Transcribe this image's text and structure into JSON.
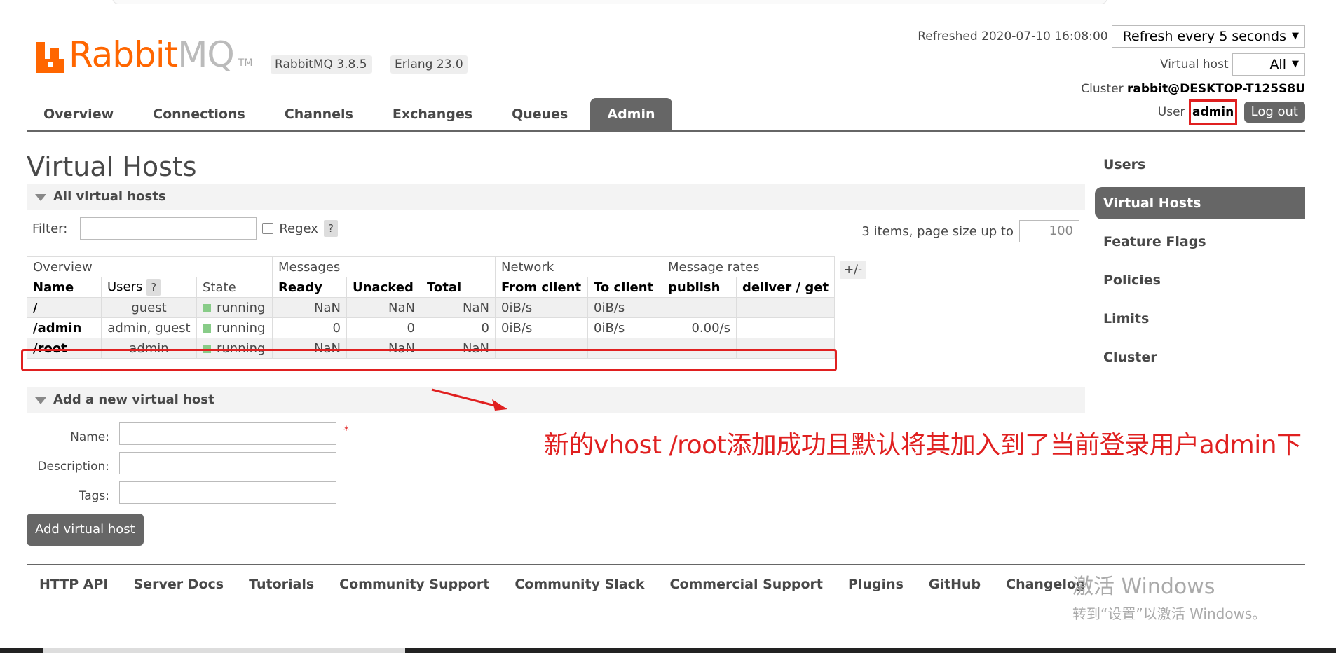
{
  "header": {
    "logo_primary": "Rabbit",
    "logo_secondary": "MQ",
    "logo_tm": "TM",
    "version_badge": "RabbitMQ 3.8.5",
    "erlang_badge": "Erlang 23.0",
    "refreshed_label": "Refreshed 2020-07-10 16:08:00",
    "refresh_select": "Refresh every 5 seconds",
    "vhost_label": "Virtual host",
    "vhost_select": "All",
    "cluster_label": "Cluster",
    "cluster_value": "rabbit@DESKTOP-T125S8U",
    "user_label": "User",
    "user_value": "admin",
    "logout_label": "Log out"
  },
  "tabs": [
    {
      "label": "Overview"
    },
    {
      "label": "Connections"
    },
    {
      "label": "Channels"
    },
    {
      "label": "Exchanges"
    },
    {
      "label": "Queues"
    },
    {
      "label": "Admin",
      "active": true
    }
  ],
  "sidebar": {
    "items": [
      {
        "label": "Users"
      },
      {
        "label": "Virtual Hosts",
        "active": true
      },
      {
        "label": "Feature Flags"
      },
      {
        "label": "Policies"
      },
      {
        "label": "Limits"
      },
      {
        "label": "Cluster"
      }
    ]
  },
  "main": {
    "title": "Virtual Hosts",
    "all_section": "All virtual hosts",
    "filter_label": "Filter:",
    "regex_label": "Regex",
    "help_glyph": "?",
    "pager_text": "3 items, page size up to",
    "page_size": "100",
    "plus_minus": "+/-"
  },
  "table": {
    "groups": [
      "Overview",
      "Messages",
      "Network",
      "Message rates"
    ],
    "columns": [
      "Name",
      "Users",
      "State",
      "Ready",
      "Unacked",
      "Total",
      "From client",
      "To client",
      "publish",
      "deliver / get"
    ],
    "rows": [
      [
        "/",
        "guest",
        "running",
        "NaN",
        "NaN",
        "NaN",
        "0iB/s",
        "0iB/s",
        "",
        ""
      ],
      [
        "/admin",
        "admin, guest",
        "running",
        "0",
        "0",
        "0",
        "0iB/s",
        "0iB/s",
        "0.00/s",
        ""
      ],
      [
        "/root",
        "admin",
        "running",
        "NaN",
        "NaN",
        "NaN",
        "",
        "",
        "",
        ""
      ]
    ]
  },
  "form": {
    "section": "Add a new virtual host",
    "name_label": "Name:",
    "description_label": "Description:",
    "tags_label": "Tags:",
    "mandatory": "*",
    "submit_label": "Add virtual host"
  },
  "annotation": "新的vhost /root添加成功且默认将其加入到了当前登录用户admin下",
  "footer": {
    "links": [
      "HTTP API",
      "Server Docs",
      "Tutorials",
      "Community Support",
      "Community Slack",
      "Commercial Support",
      "Plugins",
      "GitHub",
      "Changelog"
    ]
  },
  "watermark": {
    "line1": "激活 Windows",
    "line2": "转到“设置”以激活 Windows。"
  },
  "colors": {
    "brand": "#ff6600",
    "accent_gray": "#666666",
    "annotation_red": "#e02020",
    "state_green": "#88cc88"
  }
}
